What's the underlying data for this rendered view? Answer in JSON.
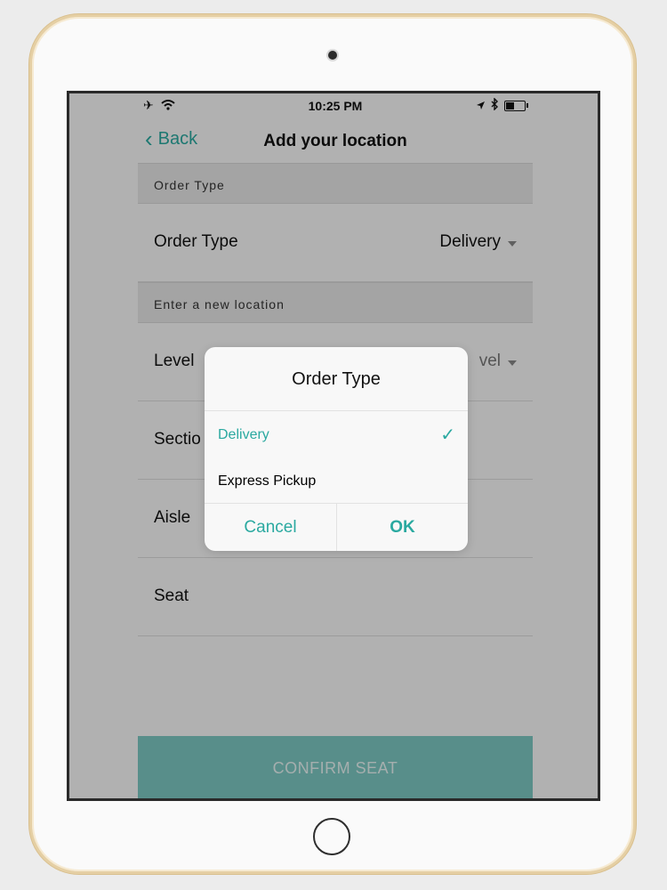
{
  "status_bar": {
    "time": "10:25 PM",
    "left_icons": [
      "airplane-icon",
      "wifi-icon"
    ],
    "right_icons": [
      "location-arrow-icon",
      "bluetooth-icon",
      "battery-icon"
    ]
  },
  "navbar": {
    "back_label": "Back",
    "title": "Add your location"
  },
  "sections": {
    "order_type_header": "Order Type",
    "new_location_header": "Enter a new location"
  },
  "order_type_row": {
    "label": "Order Type",
    "value": "Delivery"
  },
  "location_rows": [
    {
      "label": "Level",
      "value": "vel"
    },
    {
      "label": "Sectio"
    },
    {
      "label": "Aisle"
    },
    {
      "label": "Seat"
    }
  ],
  "confirm_button": "CONFIRM SEAT",
  "dialog": {
    "title": "Order Type",
    "options": [
      {
        "label": "Delivery",
        "selected": true
      },
      {
        "label": "Express Pickup",
        "selected": false
      }
    ],
    "cancel_label": "Cancel",
    "ok_label": "OK"
  },
  "colors": {
    "accent": "#2aa9a0",
    "overlay": "rgba(0,0,0,0.29)",
    "confirm_bg": "#7cc9c3"
  }
}
